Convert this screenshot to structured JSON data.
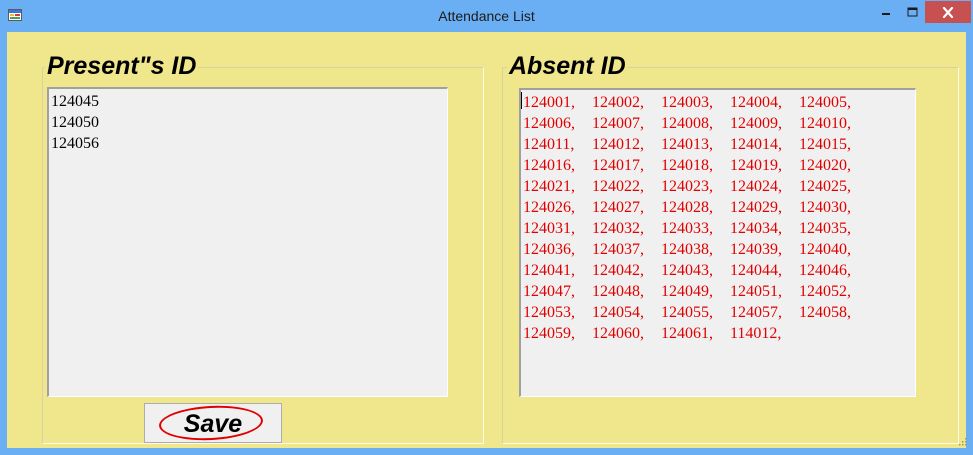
{
  "window": {
    "title": "Attendance List",
    "icons": {
      "app": "app-form-icon",
      "minimize": "minimize-icon",
      "maximize": "maximize-icon",
      "close": "close-icon"
    },
    "colors": {
      "titlebar": "#6aaef3",
      "client_background": "#f0e68c",
      "close_button": "#c75050",
      "absent_text": "#e00000",
      "save_annotation": "#e00000"
    }
  },
  "present": {
    "heading": "Present\"s ID",
    "items": [
      "124045",
      "124050",
      "124056"
    ]
  },
  "absent": {
    "heading": "Absent ID",
    "rows": [
      [
        "124001,",
        "124002,",
        "124003,",
        "124004,",
        "124005,"
      ],
      [
        "124006,",
        "124007,",
        "124008,",
        "124009,",
        "124010,"
      ],
      [
        "124011,",
        "124012,",
        "124013,",
        "124014,",
        "124015,"
      ],
      [
        "124016,",
        "124017,",
        "124018,",
        "124019,",
        "124020,"
      ],
      [
        "124021,",
        "124022,",
        "124023,",
        "124024,",
        "124025,"
      ],
      [
        "124026,",
        "124027,",
        "124028,",
        "124029,",
        "124030,"
      ],
      [
        "124031,",
        "124032,",
        "124033,",
        "124034,",
        "124035,"
      ],
      [
        "124036,",
        "124037,",
        "124038,",
        "124039,",
        "124040,"
      ],
      [
        "124041,",
        "124042,",
        "124043,",
        "124044,",
        "124046,"
      ],
      [
        "124047,",
        "124048,",
        "124049,",
        "124051,",
        "124052,"
      ],
      [
        "124053,",
        "124054,",
        "124055,",
        "124057,",
        "124058,"
      ],
      [
        "124059,",
        "124060,",
        "124061,",
        "114012,"
      ]
    ]
  },
  "actions": {
    "save_label": "Save"
  }
}
